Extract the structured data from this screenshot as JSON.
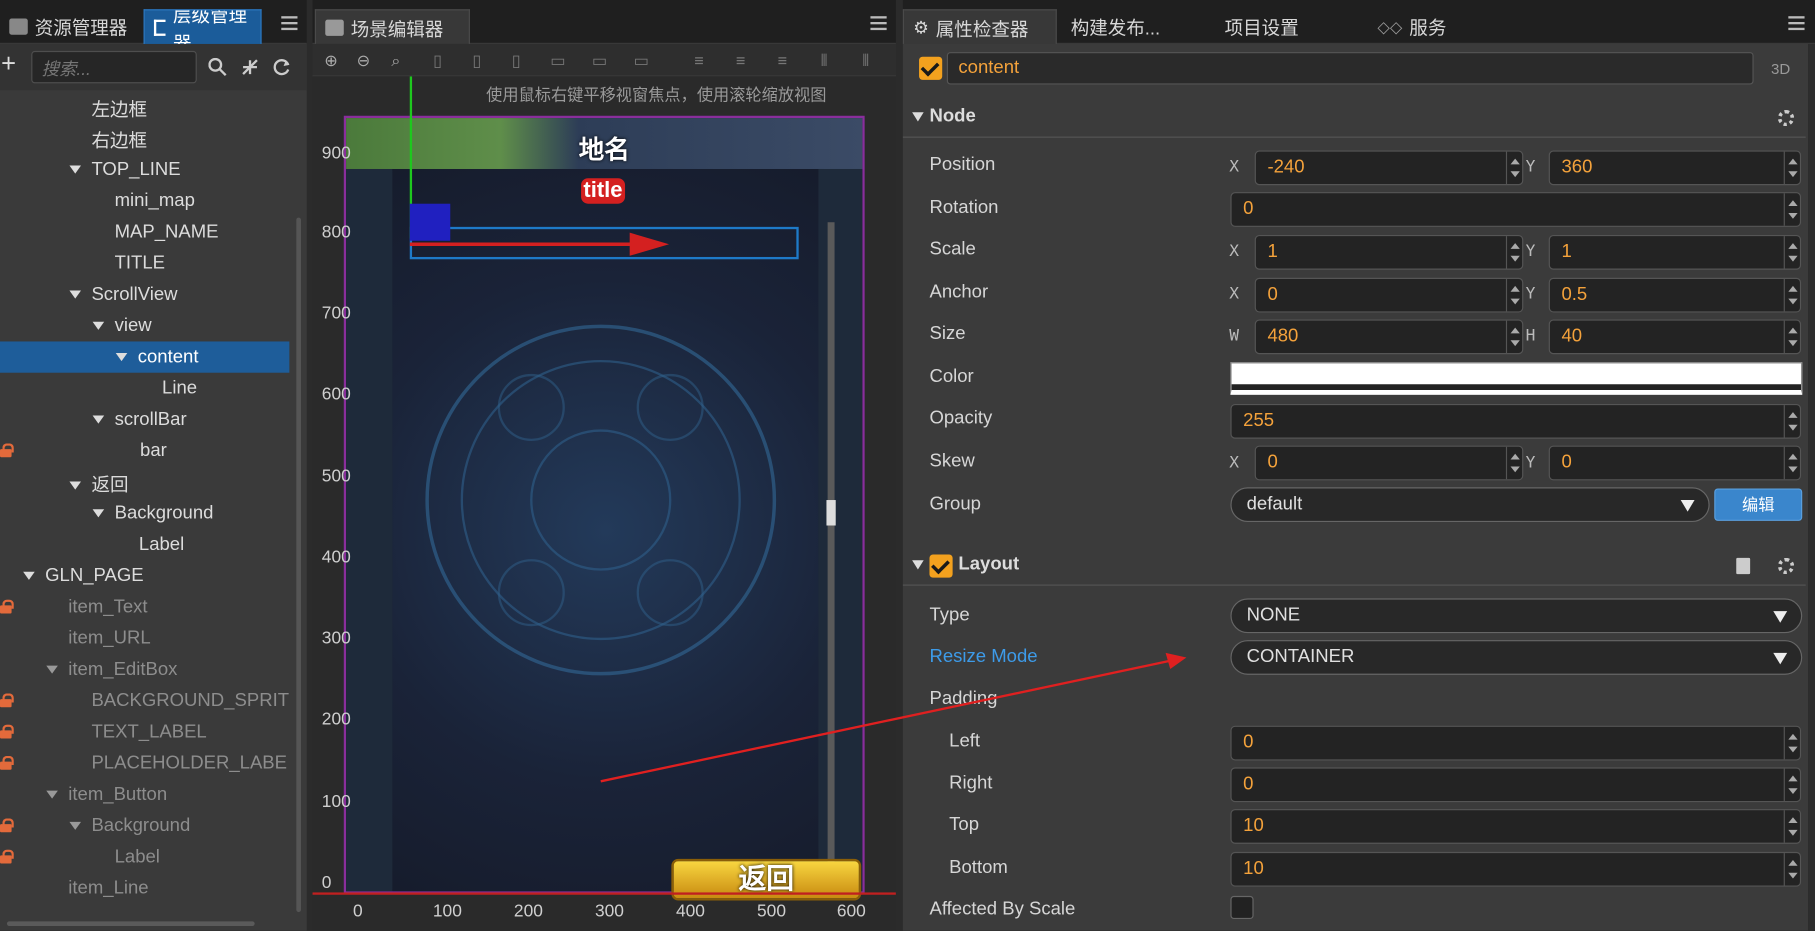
{
  "left_tabs": [
    {
      "label": "资源管理器"
    },
    {
      "label": "层级管理器"
    }
  ],
  "scene_tab": {
    "label": "场景编辑器"
  },
  "right_tabs": [
    {
      "label": "属性检查器"
    },
    {
      "label": "构建发布..."
    },
    {
      "label": "项目设置"
    },
    {
      "label": "服务"
    }
  ],
  "hierarchy": {
    "search_placeholder": "搜索...",
    "rows": [
      {
        "label": "左边框"
      },
      {
        "label": "右边框"
      },
      {
        "label": "TOP_LINE"
      },
      {
        "label": "mini_map"
      },
      {
        "label": "MAP_NAME"
      },
      {
        "label": "TITLE"
      },
      {
        "label": "ScrollView"
      },
      {
        "label": "view"
      },
      {
        "label": "content"
      },
      {
        "label": "Line"
      },
      {
        "label": "scrollBar"
      },
      {
        "label": "bar"
      },
      {
        "label": "返回"
      },
      {
        "label": "Background"
      },
      {
        "label": "Label"
      },
      {
        "label": "GLN_PAGE"
      },
      {
        "label": "item_Text"
      },
      {
        "label": "item_URL"
      },
      {
        "label": "item_EditBox"
      },
      {
        "label": "BACKGROUND_SPRIT"
      },
      {
        "label": "TEXT_LABEL"
      },
      {
        "label": "PLACEHOLDER_LABE"
      },
      {
        "label": "item_Button"
      },
      {
        "label": "Background"
      },
      {
        "label": "Label"
      },
      {
        "label": "item_Line"
      }
    ]
  },
  "scene": {
    "hint": "使用鼠标右键平移视窗焦点，使用滚轮缩放视图",
    "map_name": "地名",
    "title": "title",
    "back_button": "返回",
    "y_ticks": [
      "900",
      "800",
      "700",
      "600",
      "500",
      "400",
      "300",
      "200",
      "100",
      "0"
    ],
    "x_ticks": [
      "0",
      "100",
      "200",
      "300",
      "400",
      "500",
      "600"
    ]
  },
  "inspector": {
    "node_name": "content",
    "mode_3d": "3D",
    "node_section": "Node",
    "position": {
      "label": "Position",
      "x_axis": "X",
      "y_axis": "Y",
      "x": "-240",
      "y": "360"
    },
    "rotation": {
      "label": "Rotation",
      "value": "0"
    },
    "scale": {
      "label": "Scale",
      "x_axis": "X",
      "y_axis": "Y",
      "x": "1",
      "y": "1"
    },
    "anchor": {
      "label": "Anchor",
      "x_axis": "X",
      "y_axis": "Y",
      "x": "0",
      "y": "0.5"
    },
    "size": {
      "label": "Size",
      "w_axis": "W",
      "h_axis": "H",
      "w": "480",
      "h": "40"
    },
    "color": {
      "label": "Color",
      "value": "#ffffff"
    },
    "opacity": {
      "label": "Opacity",
      "value": "255"
    },
    "skew": {
      "label": "Skew",
      "x_axis": "X",
      "y_axis": "Y",
      "x": "0",
      "y": "0"
    },
    "group": {
      "label": "Group",
      "value": "default",
      "edit": "编辑"
    },
    "layout_section": "Layout",
    "type": {
      "label": "Type",
      "value": "NONE"
    },
    "resize_mode": {
      "label": "Resize Mode",
      "value": "CONTAINER"
    },
    "padding": {
      "label": "Padding"
    },
    "left": {
      "label": "Left",
      "value": "0"
    },
    "right": {
      "label": "Right",
      "value": "0"
    },
    "top": {
      "label": "Top",
      "value": "10"
    },
    "bottom": {
      "label": "Bottom",
      "value": "10"
    },
    "affected_by_scale": {
      "label": "Affected By Scale"
    }
  },
  "colors": {
    "accent": "#f3a11e",
    "selection": "#1e5d9a",
    "link": "#3d9be9",
    "annotation": "#e02020"
  }
}
